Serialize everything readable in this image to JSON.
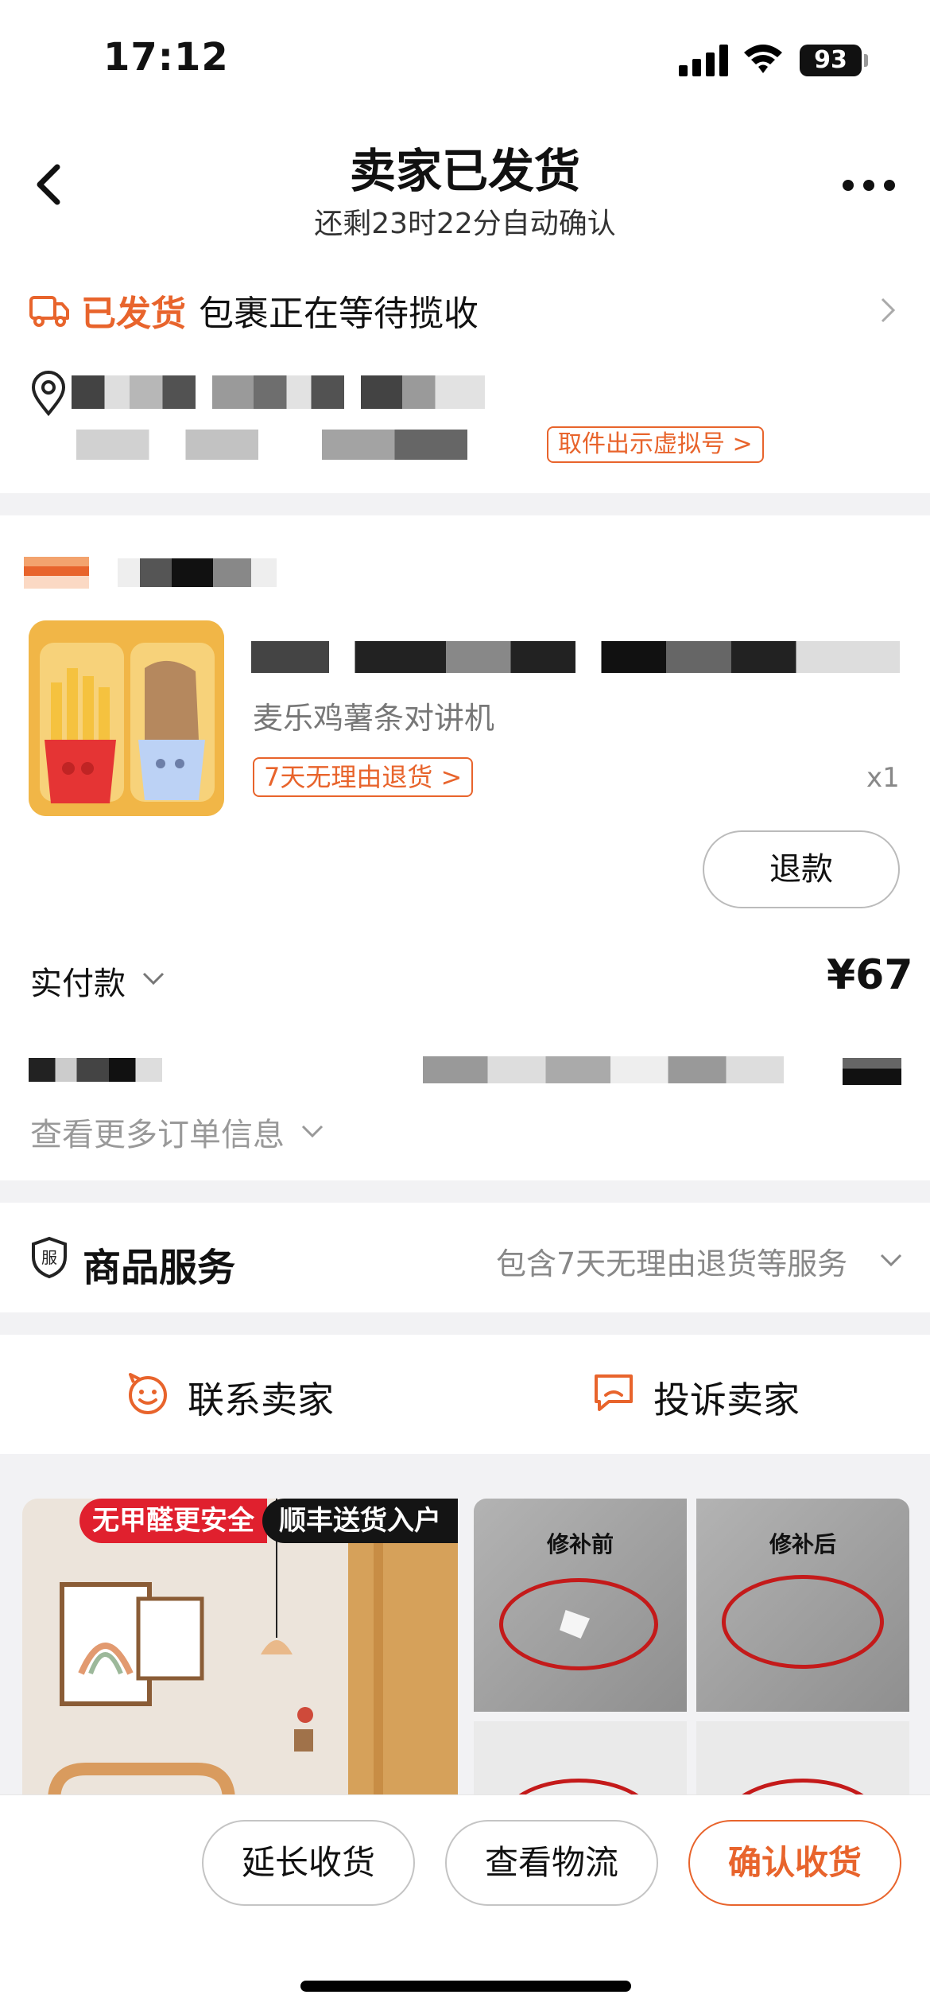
{
  "status_bar": {
    "time": "17:12",
    "battery": "93"
  },
  "header": {
    "title": "卖家已发货",
    "subtitle": "还剩23时22分自动确认"
  },
  "shipping": {
    "status": "已发货",
    "description": "包裹正在等待揽收",
    "virtual_number_button": "取件出示虚拟号 >"
  },
  "order": {
    "product_desc": "麦乐鸡薯条对讲机",
    "return_tag": "7天无理由退货 >",
    "quantity": "x1",
    "refund_button": "退款",
    "paid_label": "实付款",
    "paid_amount": "¥67",
    "more_info": "查看更多订单信息"
  },
  "services": {
    "title": "商品服务",
    "icon_glyph": "服",
    "desc": "包含7天无理由退货等服务"
  },
  "contact": {
    "contact_seller": "联系卖家",
    "complain_seller": "投诉卖家"
  },
  "recommendations": {
    "left_tag_1": "无甲醛更安全",
    "left_tag_2": "顺丰送货入户",
    "tile_before": "修补前",
    "tile_after": "修补后"
  },
  "bottom_bar": {
    "extend_button": "延长收货",
    "logistics_button": "查看物流",
    "confirm_button": "确认收货"
  },
  "colors": {
    "accent": "#e8642c",
    "red_tag": "#e0202e"
  }
}
